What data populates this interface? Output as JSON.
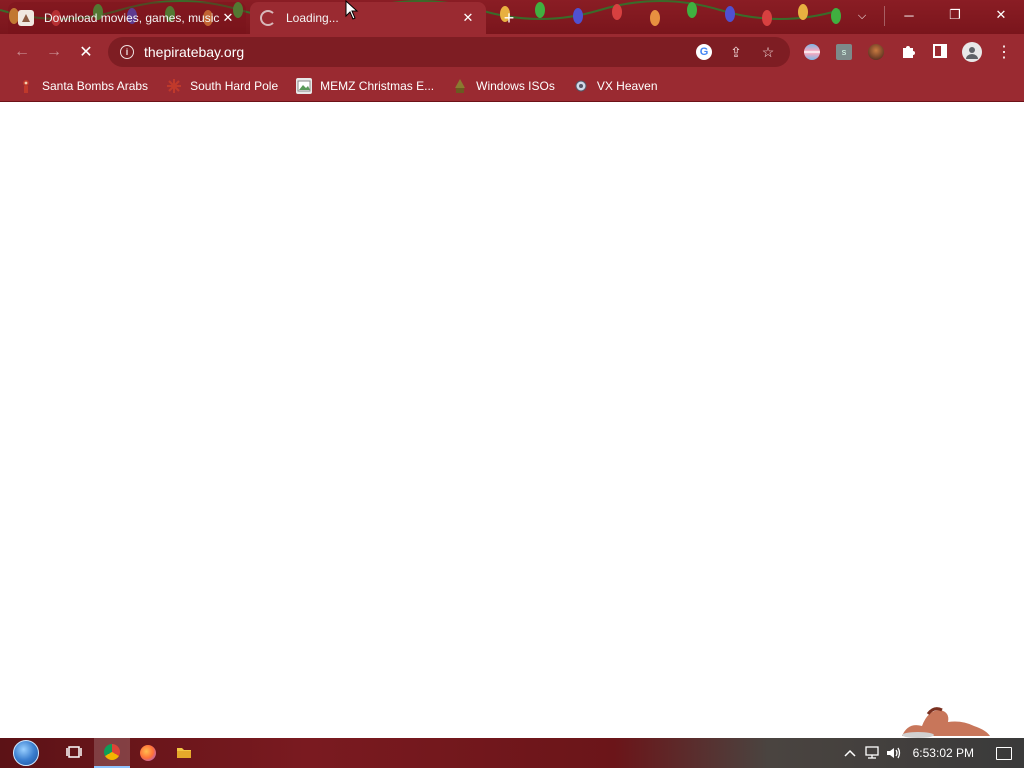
{
  "browser": {
    "tabs": [
      {
        "title": "Download movies, games, music",
        "active": false
      },
      {
        "title": "Loading...",
        "active": true
      }
    ],
    "new_tab_glyph": "+",
    "window_controls": {
      "minimize": "─",
      "restore": "❐",
      "close": "✕",
      "tab_search": "⌵"
    }
  },
  "toolbar": {
    "back_glyph": "←",
    "forward_glyph": "→",
    "stop_glyph": "✕",
    "info_glyph": "i",
    "url": "thepiratebay.org",
    "google_glyph": "G",
    "share_glyph": "⇪",
    "star_glyph": "☆",
    "extensions": [
      {
        "name": "flag-extension",
        "color": "#aab8e8"
      },
      {
        "name": "s-extension",
        "label": "s",
        "color": "#7d8a8a"
      },
      {
        "name": "avatar-extension",
        "color": "#c87a40"
      }
    ],
    "puzzle_glyph": "✦",
    "side_panel_glyph": "▮",
    "profile_glyph": "●",
    "menu_glyph": "⋮"
  },
  "bookmarks": [
    {
      "label": "Santa Bombs Arabs",
      "icon": "santa-icon",
      "color": "#c0392b"
    },
    {
      "label": "South Hard Pole",
      "icon": "snowflake-icon",
      "color": "#c0392b"
    },
    {
      "label": "MEMZ Christmas E...",
      "icon": "image-icon",
      "color": "#e0e0e0"
    },
    {
      "label": "Windows ISOs",
      "icon": "tree-icon",
      "color": "#8a7a30"
    },
    {
      "label": "VX Heaven",
      "icon": "virus-icon",
      "color": "#d0d8e8"
    }
  ],
  "taskbar": {
    "clock": "6:53:02 PM",
    "tray_chevron": "^",
    "tray_network": "▭",
    "tray_volume": "🔊"
  }
}
